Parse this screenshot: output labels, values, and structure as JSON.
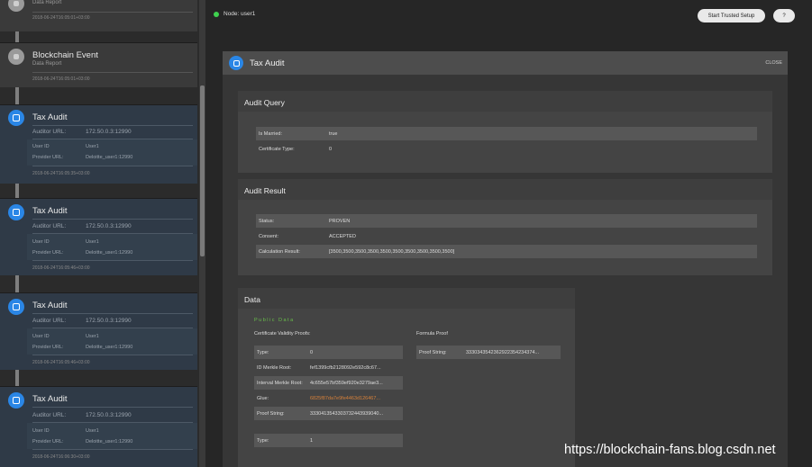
{
  "sidebar": {
    "cards": [
      {
        "title": "",
        "subtitle": "Data Report",
        "date": "2018-06-24T16:05:01+03:00"
      },
      {
        "title": "Blockchain Event",
        "subtitle": "Data Report",
        "date": "2018-06-24T16:05:01+03:00"
      },
      {
        "title": "Tax Audit",
        "auditor_label": "Auditor URL:",
        "auditor_value": "172.50.0.3:12990",
        "userid_label": "User ID",
        "userid_value": "User1",
        "provider_label": "Provider URL:",
        "provider_value": "Deloitte_user1:12990",
        "date": "2018-06-24T16:05:35+03:00"
      },
      {
        "title": "Tax Audit",
        "auditor_label": "Auditor URL:",
        "auditor_value": "172.50.0.3:12990",
        "userid_label": "User ID",
        "userid_value": "User1",
        "provider_label": "Provider URL:",
        "provider_value": "Deloitte_user1:12990",
        "date": "2018-06-24T16:05:46+03:00"
      },
      {
        "title": "Tax Audit",
        "auditor_label": "Auditor URL:",
        "auditor_value": "172.50.0.3:12990",
        "userid_label": "User ID",
        "userid_value": "User1",
        "provider_label": "Provider URL:",
        "provider_value": "Deloitte_user1:12990",
        "date": "2018-06-24T16:05:46+03:00"
      },
      {
        "title": "Tax Audit",
        "auditor_label": "Auditor URL:",
        "auditor_value": "172.50.0.3:12990",
        "userid_label": "User ID",
        "userid_value": "User1",
        "provider_label": "Provider URL:",
        "provider_value": "Deloitte_user1:12990",
        "date": "2018-06-24T16:06:30+03:00"
      }
    ]
  },
  "topbar": {
    "node_label": "Node: user1",
    "setup_button": "Start Trusted Setup",
    "help_button": "?"
  },
  "dialog": {
    "title": "Tax Audit",
    "close": "CLOSE",
    "query": {
      "title": "Audit Query",
      "rows": [
        {
          "key": "Is Married:",
          "value": "true"
        },
        {
          "key": "Certificate Type:",
          "value": "0"
        }
      ]
    },
    "result": {
      "title": "Audit Result",
      "rows": [
        {
          "key": "Status:",
          "value": "PROVEN"
        },
        {
          "key": "Consent:",
          "value": "ACCEPTED"
        },
        {
          "key": "Calculation Result:",
          "value": "[3500,3500,3500,3500,3500,3500,3500,3500,3500,3500]"
        }
      ]
    },
    "data": {
      "title": "Data",
      "public_data": "Public Data",
      "validity_heading": "Certificate Validity Proofs:",
      "formula_heading": "Formula Proof",
      "validity_rows": [
        {
          "key": "Type:",
          "value": "0"
        },
        {
          "key": "ID Merkle Root:",
          "value": "fef1399cfb2128092e592c8c67..."
        },
        {
          "key": "Interval Merkle Root:",
          "value": "4c655e57bf359ef920e3279ae3..."
        },
        {
          "key": "Glue:",
          "value": "6825f87da7e9fe4463d126467..."
        },
        {
          "key": "Proof String:",
          "value": "3330413543303732443939040..."
        }
      ],
      "formula_rows": [
        {
          "key": "Proof String:",
          "value": "3330343542362922354234374..."
        }
      ],
      "extra_row": {
        "key": "Type:",
        "value": "1"
      }
    }
  },
  "watermark": "https://blockchain-fans.blog.csdn.net",
  "colors": {
    "accent": "#2a86e6",
    "online": "#3fd14f",
    "glue": "#d6803a"
  }
}
